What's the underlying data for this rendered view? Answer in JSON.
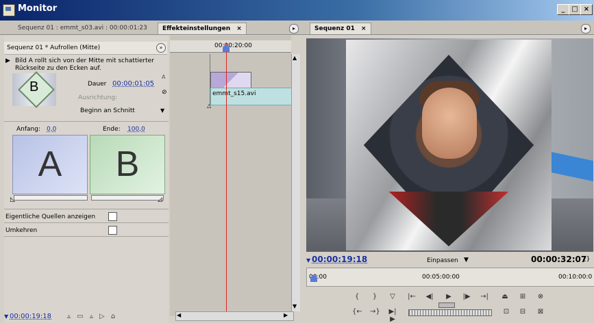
{
  "window": {
    "title": "Monitor"
  },
  "tabs": {
    "source": "Sequenz 01 : emmt_s03.avi : 00:00:01:23",
    "effects": "Effekteinstellungen",
    "close": "×",
    "program": "Sequenz 01"
  },
  "effect": {
    "header": "Sequenz 01 * Aufrollen (Mitte)",
    "description_line1": "Bild A rollt sich von der Mitte mit schattierter",
    "description_line2": "Rückseite zu den Ecken auf.",
    "thumb_letter": "B",
    "duration_label": "Dauer",
    "duration_value": "00:00:01:05",
    "alignment_label": "Ausrichtung:",
    "alignment_value": "Beginn an Schnitt",
    "side_a": "A",
    "start_label": "Anfang:",
    "start_value": "0,0",
    "end_label": "Ende:",
    "end_value": "100,0",
    "preview_a": "A",
    "preview_b": "B",
    "show_sources_label": "Eigentliche Quellen anzeigen",
    "reverse_label": "Umkehren",
    "bottom_timecode": "00:00:19:18"
  },
  "timeline": {
    "ruler_time": "00:00:20:00",
    "clip_name": "emmt_s15.avi"
  },
  "program": {
    "current_tc": "00:00:19:18",
    "fit": "Einpassen",
    "duration_tc": "00:00:32:07",
    "ruler_start": "00:00",
    "ruler_mid": "00:05:00:00",
    "ruler_end": "00:10:00:0"
  }
}
